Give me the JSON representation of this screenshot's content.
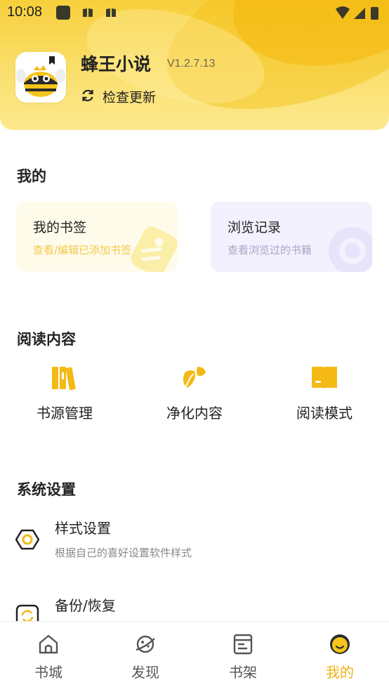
{
  "status_bar": {
    "time": "10:08"
  },
  "app": {
    "name": "蜂王小说",
    "version": "V1.2.7.13",
    "update_label": "检查更新"
  },
  "mine": {
    "title": "我的",
    "bookmarks": {
      "title": "我的书签",
      "subtitle": "查看/编辑已添加书签"
    },
    "history": {
      "title": "浏览记录",
      "subtitle": "查看浏览过的书籍"
    }
  },
  "reading": {
    "title": "阅读内容",
    "items": [
      {
        "label": "书源管理",
        "icon": "books-icon"
      },
      {
        "label": "净化内容",
        "icon": "leaf-icon"
      },
      {
        "label": "阅读模式",
        "icon": "open-book-icon"
      }
    ]
  },
  "settings": {
    "title": "系统设置",
    "items": [
      {
        "title": "样式设置",
        "subtitle": "根据自己的喜好设置软件样式",
        "icon": "hexagon-settings-icon"
      },
      {
        "title": "备份/恢复",
        "subtitle": "",
        "icon": "backup-restore-icon"
      }
    ]
  },
  "tabbar": {
    "tabs": [
      {
        "label": "书城",
        "icon": "home-icon",
        "active": false
      },
      {
        "label": "发现",
        "icon": "planet-icon",
        "active": false
      },
      {
        "label": "书架",
        "icon": "bookshelf-icon",
        "active": false
      },
      {
        "label": "我的",
        "icon": "smile-face-icon",
        "active": true
      }
    ]
  },
  "colors": {
    "accent": "#f0b312",
    "header_yellow": "#f7cf3c",
    "bookmark_card_bg": "#fffbea",
    "history_card_bg": "#f3f1fd"
  }
}
